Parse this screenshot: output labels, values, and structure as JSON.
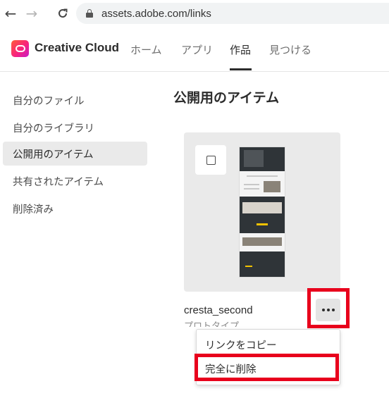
{
  "browser": {
    "url": "assets.adobe.com/links",
    "back_icon": "←",
    "forward_icon": "→",
    "reload_icon": "C"
  },
  "app": {
    "brand": "Creative Cloud",
    "nav": [
      "ホーム",
      "アプリ",
      "作品",
      "見つける"
    ],
    "active_nav": "作品"
  },
  "sidebar": {
    "items": [
      {
        "label": "自分のファイル"
      },
      {
        "label": "自分のライブラリ"
      },
      {
        "label": "公開用のアイテム"
      },
      {
        "label": "共有されたアイテム"
      },
      {
        "label": "削除済み"
      }
    ],
    "active": "公開用のアイテム"
  },
  "main": {
    "title": "公開用のアイテム",
    "item": {
      "name": "cresta_second",
      "subtitle": "プロトタイプ"
    }
  },
  "context_menu": {
    "items": [
      "リンクをコピー",
      "完全に削除"
    ]
  },
  "highlight_color": "#e8001c"
}
